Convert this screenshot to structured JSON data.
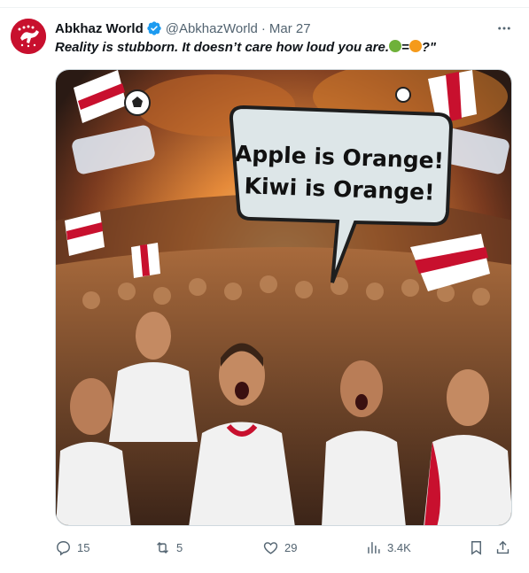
{
  "tweet": {
    "author_name": "Abkhaz World",
    "handle": "@AbkhazWorld",
    "separator": "·",
    "date": "Mar 27",
    "text_before": "Reality is stubborn. It doesn’t care how loud you are.",
    "text_equals": "=",
    "text_after": "?\"",
    "icons": {
      "apple": "green-apple-icon",
      "orange": "orange-icon"
    }
  },
  "image": {
    "bubble_line1": "Apple is Orange!",
    "bubble_line2": "Kiwi is Orange!"
  },
  "actions": {
    "replies": "15",
    "reposts": "5",
    "likes": "29",
    "views": "3.4K"
  },
  "colors": {
    "accent": "#1d9bf0",
    "muted": "#536471",
    "flag_red": "#c8102e"
  }
}
